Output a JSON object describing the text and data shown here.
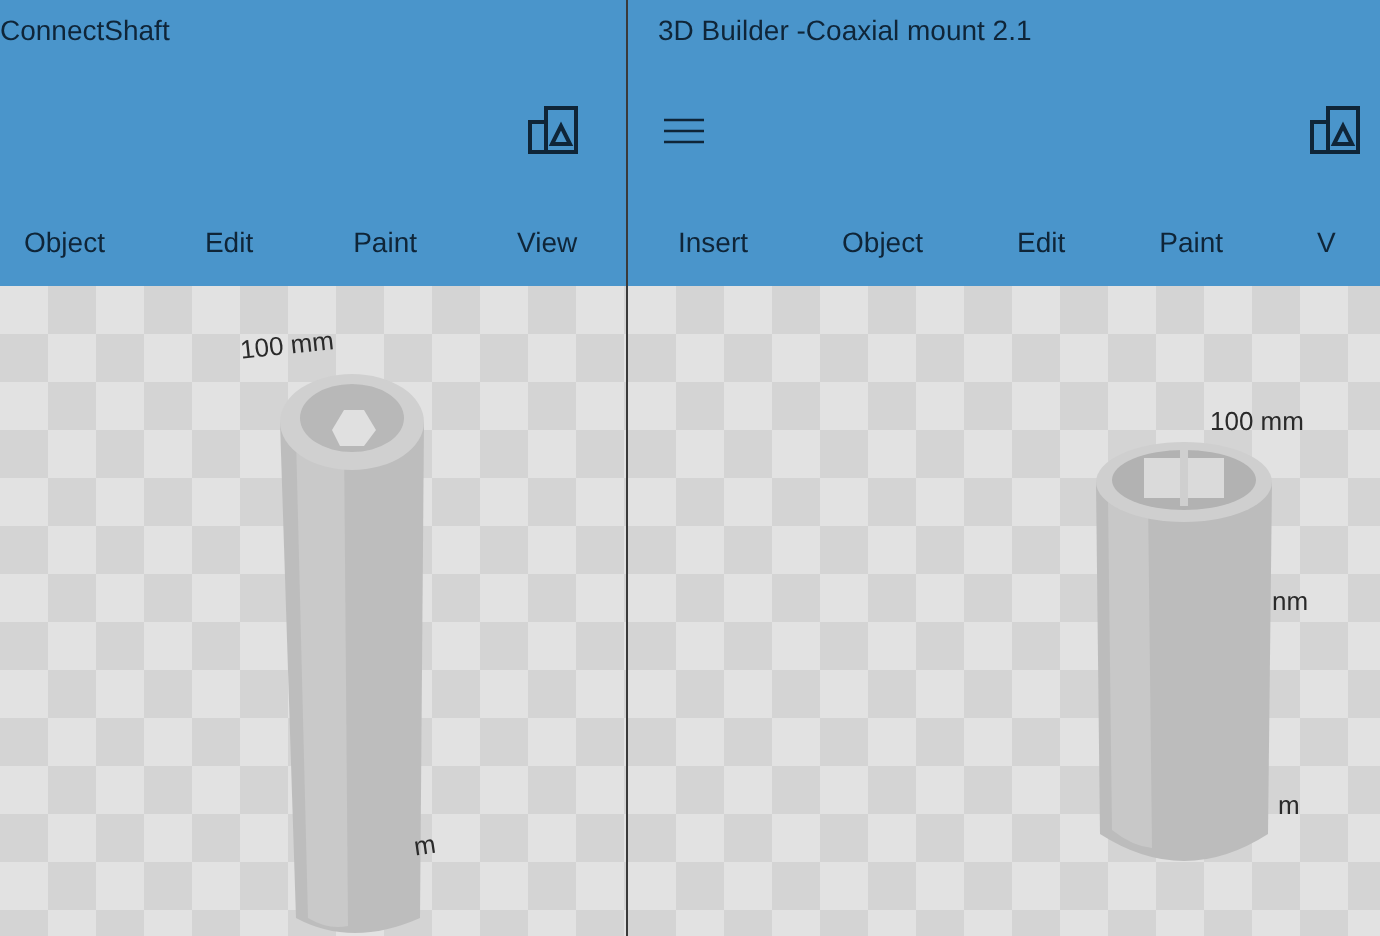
{
  "windows": [
    {
      "title": "ConnectShaft",
      "menu_button": false,
      "tabs": [
        "Object",
        "Edit",
        "Paint",
        "View"
      ],
      "scale_labels": [
        "100 mm",
        "m"
      ]
    },
    {
      "title": "3D Builder -Coaxial mount 2.1",
      "menu_button": true,
      "tabs": [
        "Insert",
        "Object",
        "Edit",
        "Paint",
        "V"
      ],
      "scale_labels": [
        "100 mm",
        "nm",
        "m"
      ]
    }
  ]
}
